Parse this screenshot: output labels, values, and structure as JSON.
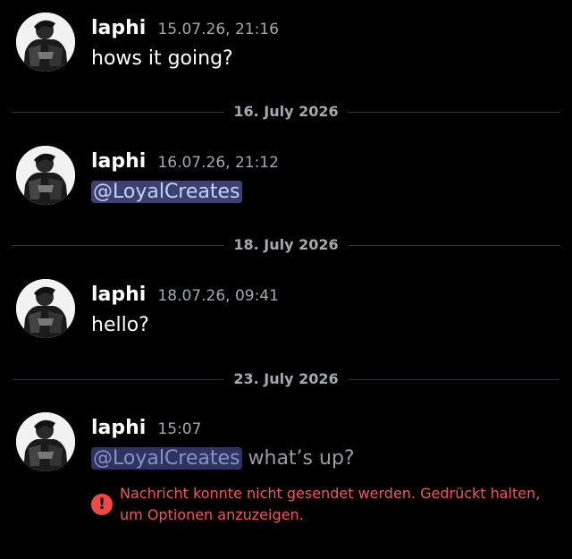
{
  "messages": [
    {
      "username": "laphi",
      "timestamp": "15.07.26, 21:16",
      "text": "hows it going?"
    },
    {
      "username": "laphi",
      "timestamp": "16.07.26, 21:12",
      "mention": "@LoyalCreates"
    },
    {
      "username": "laphi",
      "timestamp": "18.07.26, 09:41",
      "text": "hello?"
    },
    {
      "username": "laphi",
      "timestamp": "15:07",
      "mention": "@LoyalCreates",
      "text": " what’s up?"
    }
  ],
  "dividers": [
    "16. July 2026",
    "18. July 2026",
    "23. July 2026"
  ],
  "error": {
    "icon": "exclamation-icon",
    "glyph": "!",
    "text": "Nachricht konnte nicht gesendet werden. Gedrückt halten, um Optionen anzuzeigen."
  },
  "colors": {
    "background": "#000000",
    "mention_bg": "#3c4270",
    "mention_text": "#c9cdfb",
    "timestamp": "#a6a8b0",
    "error": "#f2555a"
  }
}
